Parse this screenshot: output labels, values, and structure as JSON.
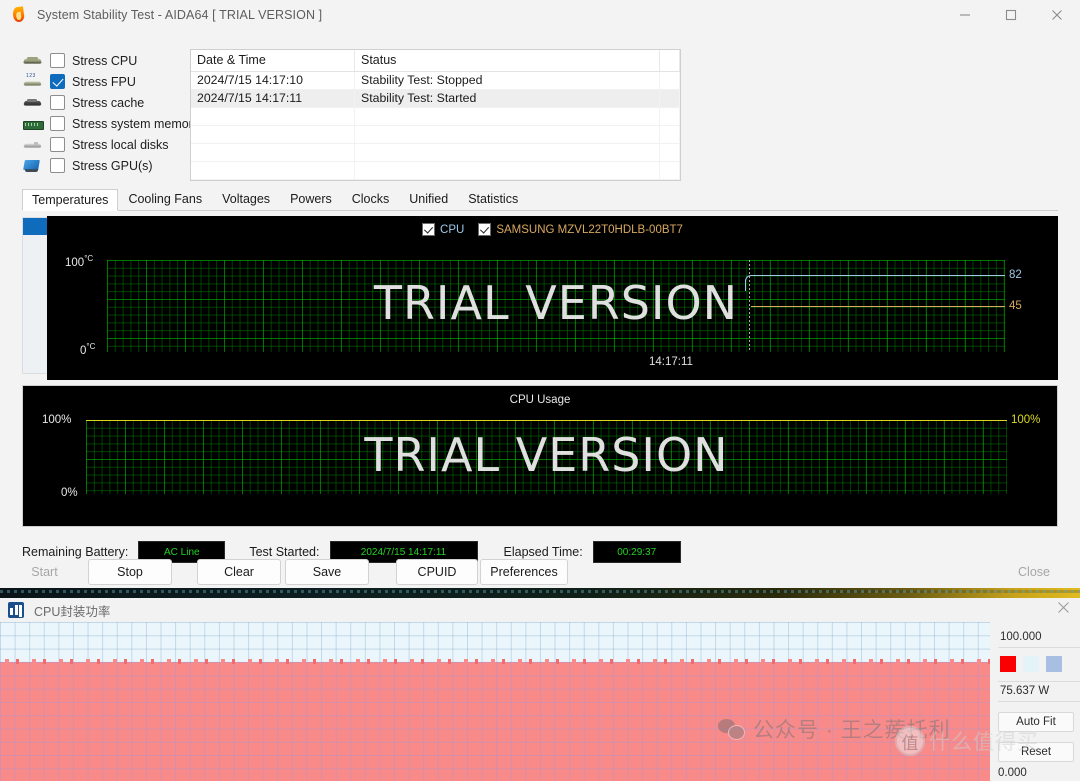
{
  "window": {
    "title": "System Stability Test - AIDA64  [ TRIAL VERSION ]",
    "minimize": "–",
    "maximize": "□",
    "close": "✕"
  },
  "stress_options": [
    {
      "label": "Stress CPU",
      "checked": false,
      "icon": "cpu-icon"
    },
    {
      "label": "Stress FPU",
      "checked": true,
      "icon": "fpu-icon"
    },
    {
      "label": "Stress cache",
      "checked": false,
      "icon": "cache-icon"
    },
    {
      "label": "Stress system memory",
      "checked": false,
      "icon": "memory-icon"
    },
    {
      "label": "Stress local disks",
      "checked": false,
      "icon": "disk-icon"
    },
    {
      "label": "Stress GPU(s)",
      "checked": false,
      "icon": "gpu-icon"
    }
  ],
  "log": {
    "columns": [
      "Date & Time",
      "Status",
      ""
    ],
    "rows": [
      {
        "datetime": "2024/7/15 14:17:10",
        "status": "Stability Test: Stopped"
      },
      {
        "datetime": "2024/7/15 14:17:11",
        "status": "Stability Test: Started"
      }
    ]
  },
  "tabs": [
    {
      "label": "Temperatures",
      "active": true
    },
    {
      "label": "Cooling Fans",
      "active": false
    },
    {
      "label": "Voltages",
      "active": false
    },
    {
      "label": "Powers",
      "active": false
    },
    {
      "label": "Clocks",
      "active": false
    },
    {
      "label": "Unified",
      "active": false
    },
    {
      "label": "Statistics",
      "active": false
    }
  ],
  "chart_data": [
    {
      "type": "line",
      "name": "temperatures",
      "title": "",
      "ylabel_top": "100",
      "ylabel_top_unit": "°C",
      "ylabel_bottom": "0",
      "ylabel_bottom_unit": "°C",
      "ylim": [
        0,
        100
      ],
      "grid": true,
      "watermark": "TRIAL VERSION",
      "time_cursor_label": "14:17:11",
      "legend": [
        {
          "label": "CPU",
          "checked": true,
          "color": "#9fc8e8"
        },
        {
          "label": "SAMSUNG MZVL22T0HDLB-00BT7",
          "checked": true,
          "color": "#d8a860"
        }
      ],
      "series": [
        {
          "name": "CPU",
          "current_value": "82",
          "value": 82,
          "color": "#9fc8e8"
        },
        {
          "name": "SAMSUNG MZVL22T0HDLB-00BT7",
          "current_value": "45",
          "value": 45,
          "color": "#d8a860"
        }
      ]
    },
    {
      "type": "line",
      "name": "cpu-usage",
      "title": "CPU Usage",
      "ylabel_top": "100%",
      "ylabel_bottom": "0%",
      "ylim": [
        0,
        100
      ],
      "grid": true,
      "watermark": "TRIAL VERSION",
      "series": [
        {
          "name": "CPU Usage",
          "current_value": "100%",
          "value": 100,
          "color": "#d8d820"
        }
      ]
    },
    {
      "type": "area",
      "name": "cpu-package-power",
      "title": "CPU封装功率",
      "max_value": "100.000",
      "current_value": "75.637 W",
      "min_value": "0.000",
      "fill_color": "#f98a8a",
      "bg_color": "#eaf6fb",
      "value": 75.637,
      "ylim": [
        0,
        100
      ]
    }
  ],
  "status": {
    "battery_label": "Remaining Battery:",
    "battery_value": "AC Line",
    "test_started_label": "Test Started:",
    "test_started_value": "2024/7/15 14:17:11",
    "elapsed_label": "Elapsed Time:",
    "elapsed_value": "00:29:37"
  },
  "buttons": [
    {
      "label": "Start",
      "disabled": true
    },
    {
      "label": "Stop",
      "disabled": false
    },
    {
      "label": "Clear",
      "disabled": false
    },
    {
      "label": "Save",
      "disabled": false
    },
    {
      "label": "CPUID",
      "disabled": false
    },
    {
      "label": "Preferences",
      "disabled": false
    },
    {
      "label": "Close",
      "disabled": true
    }
  ],
  "bottom_window": {
    "title": "CPU封装功率",
    "close": "✕",
    "max_value": "100.000",
    "current_value": "75.637 W",
    "min_value": "0.000",
    "swatches": [
      "#fb0000",
      "#e4f3f8",
      "#a8bfe3"
    ],
    "auto_fit_label": "Auto Fit",
    "reset_label": "Reset"
  },
  "watermark": {
    "wechat_text": "公众号 · 王之蒺托利",
    "badge_char": "值",
    "badge_text": "什么值得买"
  }
}
